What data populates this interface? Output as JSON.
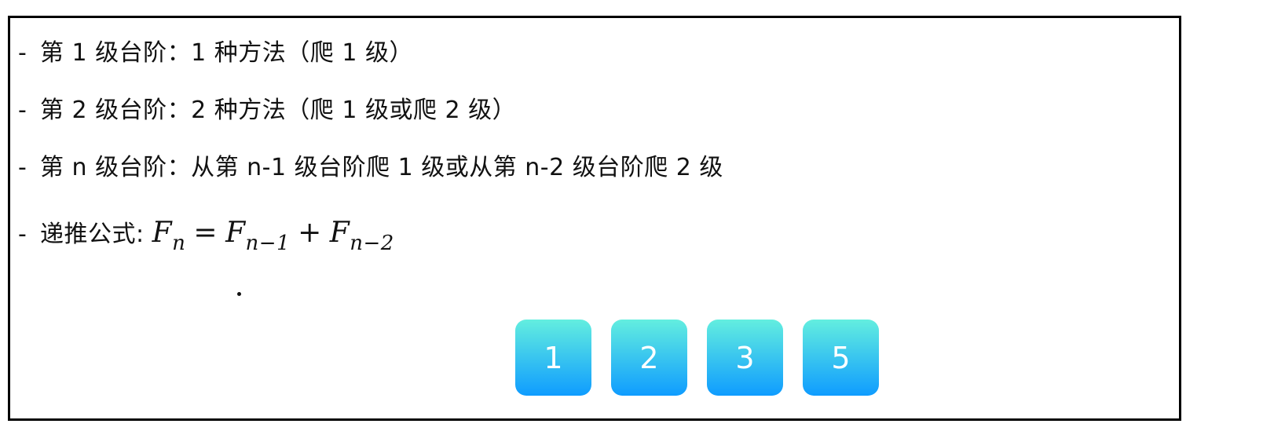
{
  "lines": [
    "第 1 级台阶：1 种方法（爬 1 级）",
    "第 2 级台阶：2 种方法（爬 1 级或爬 2 级）",
    "第 n 级台阶：从第 n-1 级台阶爬 1 级或从第 n-2 级台阶爬 2 级"
  ],
  "bullet": "-",
  "formula": {
    "label": "递推公式: ",
    "lhs_var": "F",
    "lhs_sub": "n",
    "equals": "=",
    "t1_var": "F",
    "t1_sub": "n−1",
    "plus": "+",
    "t2_var": "F",
    "t2_sub": "n−2"
  },
  "tiles": [
    "1",
    "2",
    "3",
    "5"
  ],
  "colors": {
    "tile_top": "#63eedf",
    "tile_bottom": "#0f9cff",
    "border": "#000000"
  }
}
